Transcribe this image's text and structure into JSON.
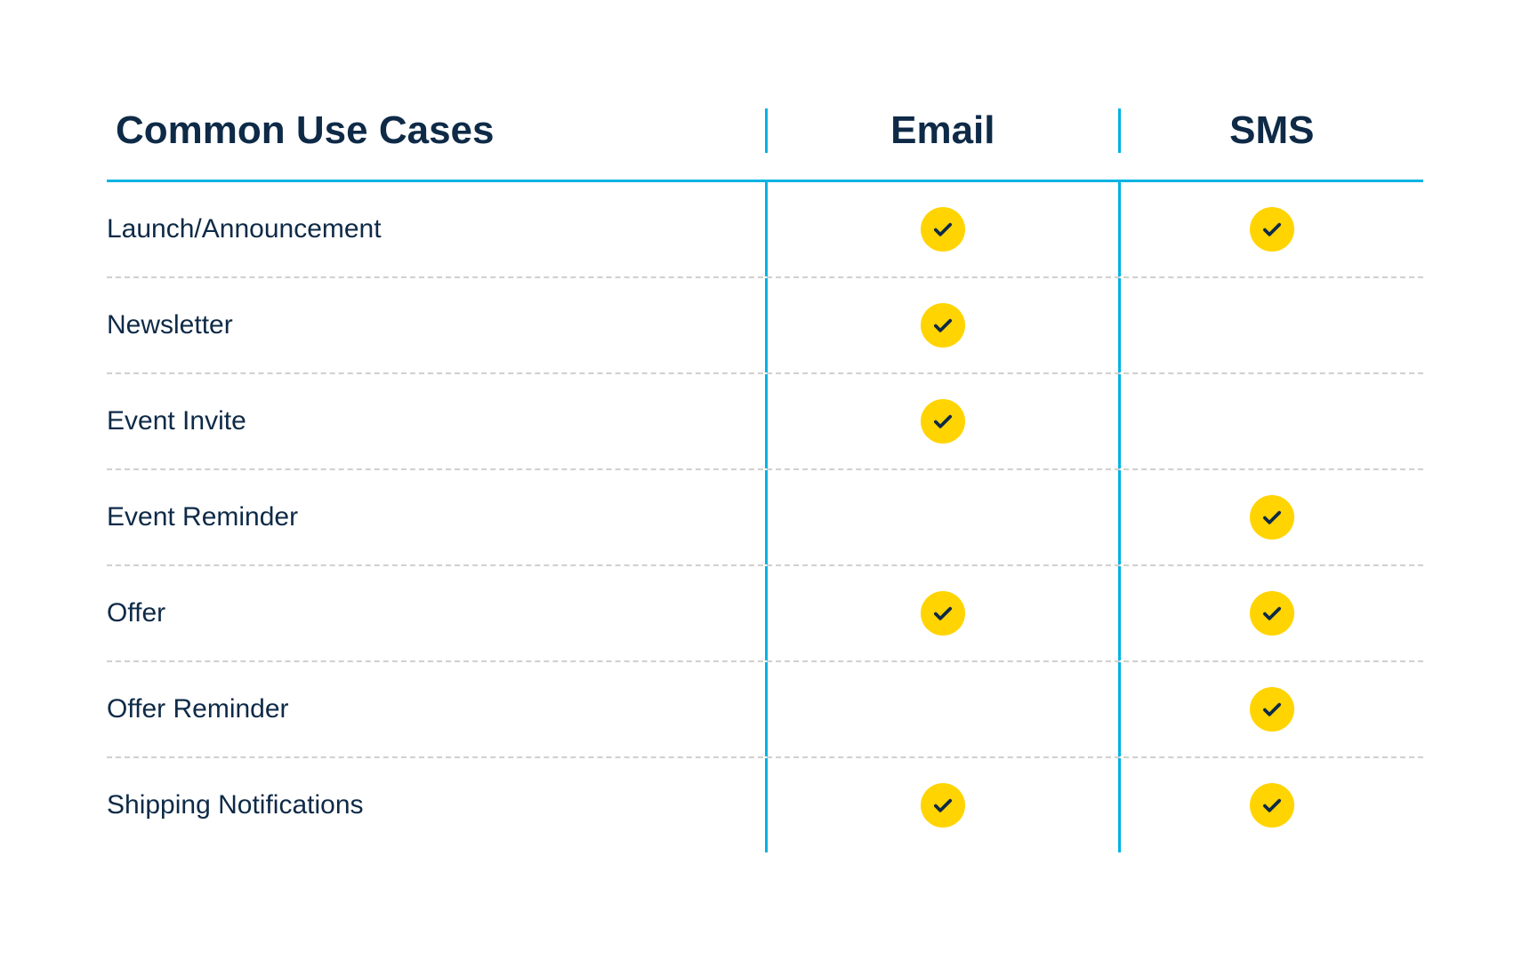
{
  "chart_data": {
    "type": "table",
    "title": "Common Use Cases",
    "columns": [
      "Email",
      "SMS"
    ],
    "rows": [
      {
        "label": "Launch/Announcement",
        "values": [
          true,
          true
        ]
      },
      {
        "label": "Newsletter",
        "values": [
          true,
          false
        ]
      },
      {
        "label": "Event Invite",
        "values": [
          true,
          false
        ]
      },
      {
        "label": "Event Reminder",
        "values": [
          false,
          true
        ]
      },
      {
        "label": "Offer",
        "values": [
          true,
          true
        ]
      },
      {
        "label": "Offer Reminder",
        "values": [
          false,
          true
        ]
      },
      {
        "label": "Shipping Notifications",
        "values": [
          true,
          true
        ]
      }
    ]
  },
  "colors": {
    "accent": "#00b3e3",
    "text": "#0e2a47",
    "badge": "#ffd400",
    "divider": "#d0d0d0"
  }
}
